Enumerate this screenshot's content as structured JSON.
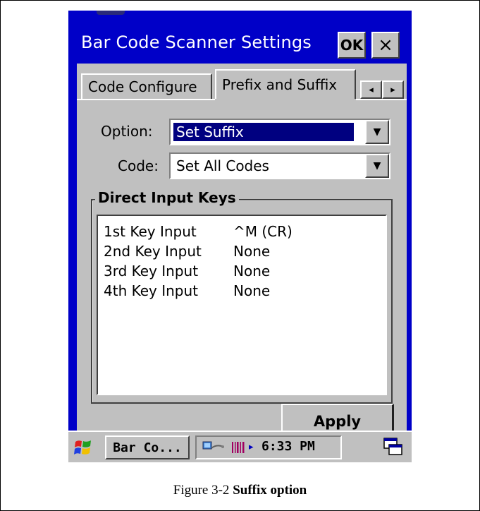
{
  "window": {
    "title": "Bar Code Scanner Settings",
    "ok_label": "OK",
    "close_label": "×"
  },
  "tabs": [
    {
      "label": "Code Configure",
      "active": false
    },
    {
      "label": "Prefix and Suffix",
      "active": true
    }
  ],
  "tab_scroll": {
    "left": "◂",
    "right": "▸"
  },
  "form": {
    "option_label": "Option:",
    "option_value": "Set Suffix",
    "code_label": "Code:",
    "code_value": "Set All Codes",
    "dropdown_glyph": "▼"
  },
  "direct_input": {
    "group_label": "Direct Input Keys",
    "rows": [
      {
        "key": "1st  Key Input",
        "value": "^M (CR)"
      },
      {
        "key": "2nd Key Input",
        "value": "None"
      },
      {
        "key": "3rd Key Input",
        "value": "None"
      },
      {
        "key": "4th Key Input",
        "value": "None"
      }
    ]
  },
  "apply_label": "Apply",
  "taskbar": {
    "task_label": "Bar Co...",
    "time": "6:33 PM",
    "tray_arrow": "▸"
  },
  "caption": {
    "prefix": "Figure 3-2 ",
    "bold": "Suffix option"
  },
  "colors": {
    "title_bar": "#0000c8",
    "window_face": "#c0c0c0",
    "selection": "#000080"
  }
}
